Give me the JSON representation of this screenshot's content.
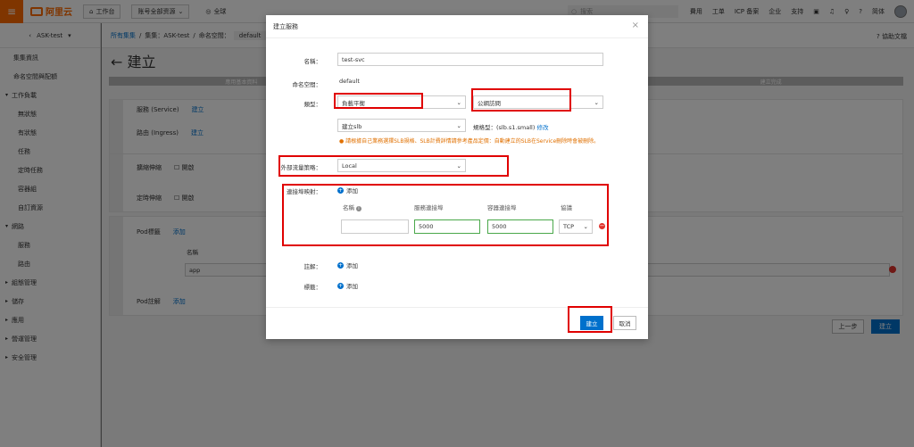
{
  "topbar": {
    "logo": "阿里云",
    "workbench": "工作台",
    "resources": "账号全部资源",
    "region": "全球",
    "search_placeholder": "搜索",
    "nav": [
      "費用",
      "工单",
      "ICP 备案",
      "企业",
      "支持"
    ],
    "lang": "简体"
  },
  "sidebar": {
    "cluster": "ASK-test",
    "items": [
      {
        "label": "集集資訊",
        "type": "item"
      },
      {
        "label": "命名空間與配額",
        "type": "item"
      },
      {
        "label": "工作負載",
        "type": "grp-open"
      },
      {
        "label": "無狀態",
        "type": "sub"
      },
      {
        "label": "有狀態",
        "type": "sub"
      },
      {
        "label": "任務",
        "type": "sub"
      },
      {
        "label": "定時任務",
        "type": "sub"
      },
      {
        "label": "容器組",
        "type": "sub"
      },
      {
        "label": "自訂資源",
        "type": "sub"
      },
      {
        "label": "網路",
        "type": "grp-open"
      },
      {
        "label": "服務",
        "type": "sub"
      },
      {
        "label": "路由",
        "type": "sub"
      },
      {
        "label": "組態管理",
        "type": "grp"
      },
      {
        "label": "儲存",
        "type": "grp"
      },
      {
        "label": "應用",
        "type": "grp"
      },
      {
        "label": "營運管理",
        "type": "grp"
      },
      {
        "label": "安全管理",
        "type": "grp"
      }
    ]
  },
  "main": {
    "breadcrumb": {
      "all": "所有集集",
      "sep": "/",
      "cluster": "集集：ASK-test",
      "ns_label": "命名空間：",
      "ns_value": "default"
    },
    "help": "協助文檔",
    "title": "← 建立",
    "steps": [
      "應用基本資料",
      "建立完成"
    ],
    "service_label": "服務 (Service)",
    "ingress_label": "路由 (Ingress)",
    "create_link": "建立",
    "scale_label": "擴縮伸縮",
    "cron_label": "定時伸縮",
    "enable": "開啟",
    "pod_tags": "Pod標籤",
    "pod_notes": "Pod註解",
    "add_link": "添加",
    "name_col": "名稱",
    "app_value": "app",
    "prev_btn": "上一步",
    "next_btn": "建立"
  },
  "modal": {
    "title": "建立服務",
    "name_label": "名稱：",
    "name_value": "test-svc",
    "ns_label": "命名空間：",
    "ns_value": "default",
    "type_label": "類型：",
    "type_value": "負載平衡",
    "access_value": "公網訪問",
    "slb_value": "建立slb",
    "spec_text": "規格型：(slb.s1.small)",
    "edit_link": "修改",
    "warning": "請根據自己業務選擇SLB規格、SLB計費詳情請參考產品定價：自動建立的SLB在Service刪除時會被刪除。",
    "policy_label": "外部流量策略：",
    "policy_value": "Local",
    "port_label": "連接埠映射：",
    "add": "添加",
    "cols": [
      "名稱",
      "服務連接埠",
      "容器連接埠",
      "協議"
    ],
    "service_port": "5000",
    "container_port": "5000",
    "protocol": "TCP",
    "annotation_label": "註解：",
    "label_label": "標籤：",
    "create_btn": "建立",
    "cancel_btn": "取消"
  }
}
